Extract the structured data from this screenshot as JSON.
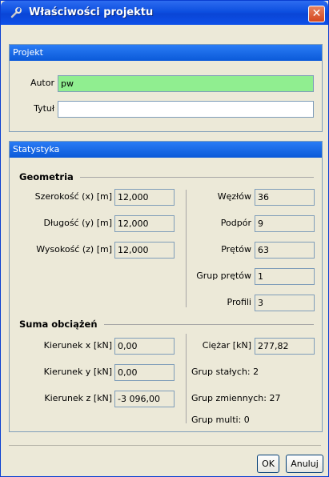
{
  "window": {
    "title": "Właściwości projektu",
    "close_glyph": "✕"
  },
  "projekt": {
    "header": "Projekt",
    "autor_label": "Autor",
    "autor_value": "pw",
    "tytul_label": "Tytuł",
    "tytul_value": ""
  },
  "statystyka": {
    "header": "Statystyka",
    "geometria": {
      "title": "Geometria",
      "szerokosc_label": "Szerokość (x) [m]",
      "szerokosc_value": "12,000",
      "dlugosc_label": "Długość (y) [m]",
      "dlugosc_value": "12,000",
      "wysokosc_label": "Wysokość (z) [m]",
      "wysokosc_value": "12,000",
      "wezlow_label": "Węzłów",
      "wezlow_value": "36",
      "podpor_label": "Podpór",
      "podpor_value": "9",
      "pretow_label": "Prętów",
      "pretow_value": "63",
      "grup_pretow_label": "Grup prętów",
      "grup_pretow_value": "1",
      "profili_label": "Profili",
      "profili_value": "3"
    },
    "suma": {
      "title": "Suma obciążeń",
      "kx_label": "Kierunek x [kN]",
      "kx_value": "0,00",
      "ky_label": "Kierunek y [kN]",
      "ky_value": "0,00",
      "kz_label": "Kierunek z [kN]",
      "kz_value": "-3 096,00",
      "ciezar_label": "Ciężar [kN]",
      "ciezar_value": "277,82",
      "grup_stalych": "Grup stałych: 2",
      "grup_zmiennych": "Grup zmiennych: 27",
      "grup_multi": "Grup multi: 0"
    }
  },
  "buttons": {
    "ok": "OK",
    "anuluj": "Anuluj"
  },
  "colors": {
    "title_bar": "#0a45d6",
    "panel_header": "#1468e0",
    "author_field": "#90ee90",
    "background": "#ece9d8"
  }
}
